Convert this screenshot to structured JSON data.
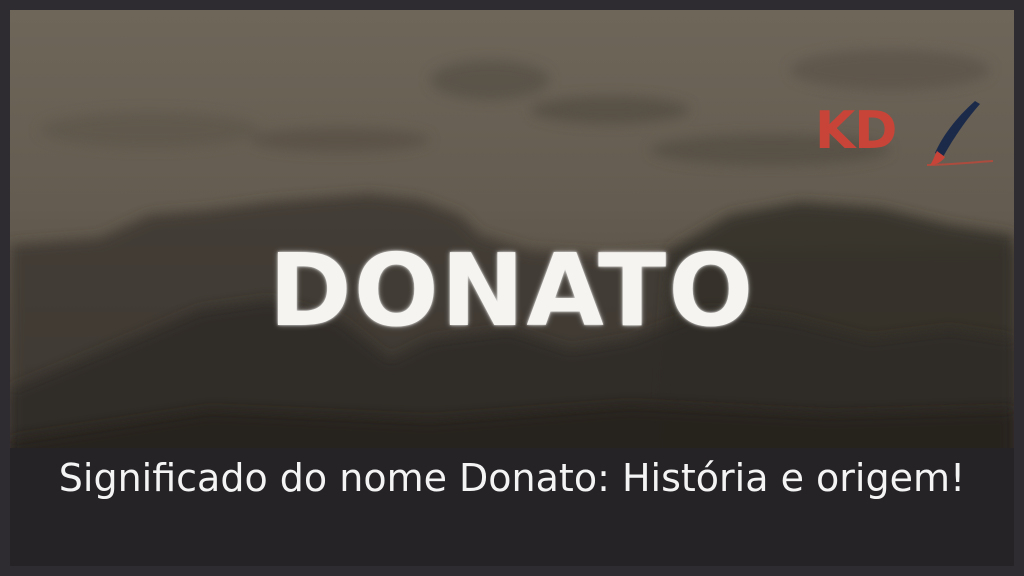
{
  "image": {
    "headline": "DONATO",
    "logo": {
      "text": "KD",
      "brand_color": "#c94438",
      "icon": "paintbrush-icon"
    },
    "caption": "Significado do nome Donato: História e origem!"
  },
  "colors": {
    "caption_background": "#252326",
    "caption_text": "#f4f4f4",
    "headline_text": "#f6f4f0"
  }
}
